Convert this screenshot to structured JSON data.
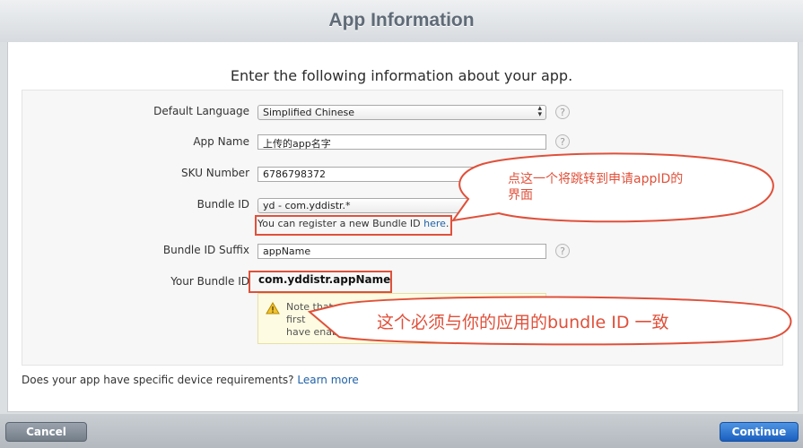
{
  "window": {
    "title": "App Information"
  },
  "heading": "Enter the following information about your app.",
  "form": {
    "default_language": {
      "label": "Default Language",
      "value": "Simplified Chinese"
    },
    "app_name": {
      "label": "App Name",
      "value": "上传的app名字"
    },
    "sku_number": {
      "label": "SKU Number",
      "value": "6786798372"
    },
    "bundle_id": {
      "label": "Bundle ID",
      "value": "yd - com.yddistr.*",
      "register_text": "You can register a new Bundle ID ",
      "register_link": "here",
      "register_suffix": "."
    },
    "bundle_id_suffix": {
      "label": "Bundle ID Suffix",
      "value": "appName"
    },
    "your_bundle_id": {
      "label": "Your Bundle ID",
      "value": "com.yddistr.appName"
    },
    "help_glyph": "?"
  },
  "warning": {
    "text": "Note that\nfirst\nhave enab"
  },
  "annotations": {
    "bubble1_line1": "点这一个将跳转到申请appID的",
    "bubble1_line2": "界面",
    "bubble2": "这个必须与你的应用的bundle ID 一致",
    "color": "#e0503a"
  },
  "requirements": {
    "text": "Does your app have specific device requirements? ",
    "link": "Learn more"
  },
  "footer": {
    "cancel": "Cancel",
    "continue": "Continue"
  },
  "icons": {
    "warning": "warning-triangle-icon",
    "help": "help-icon",
    "select_arrows": "select-arrows-icon"
  }
}
